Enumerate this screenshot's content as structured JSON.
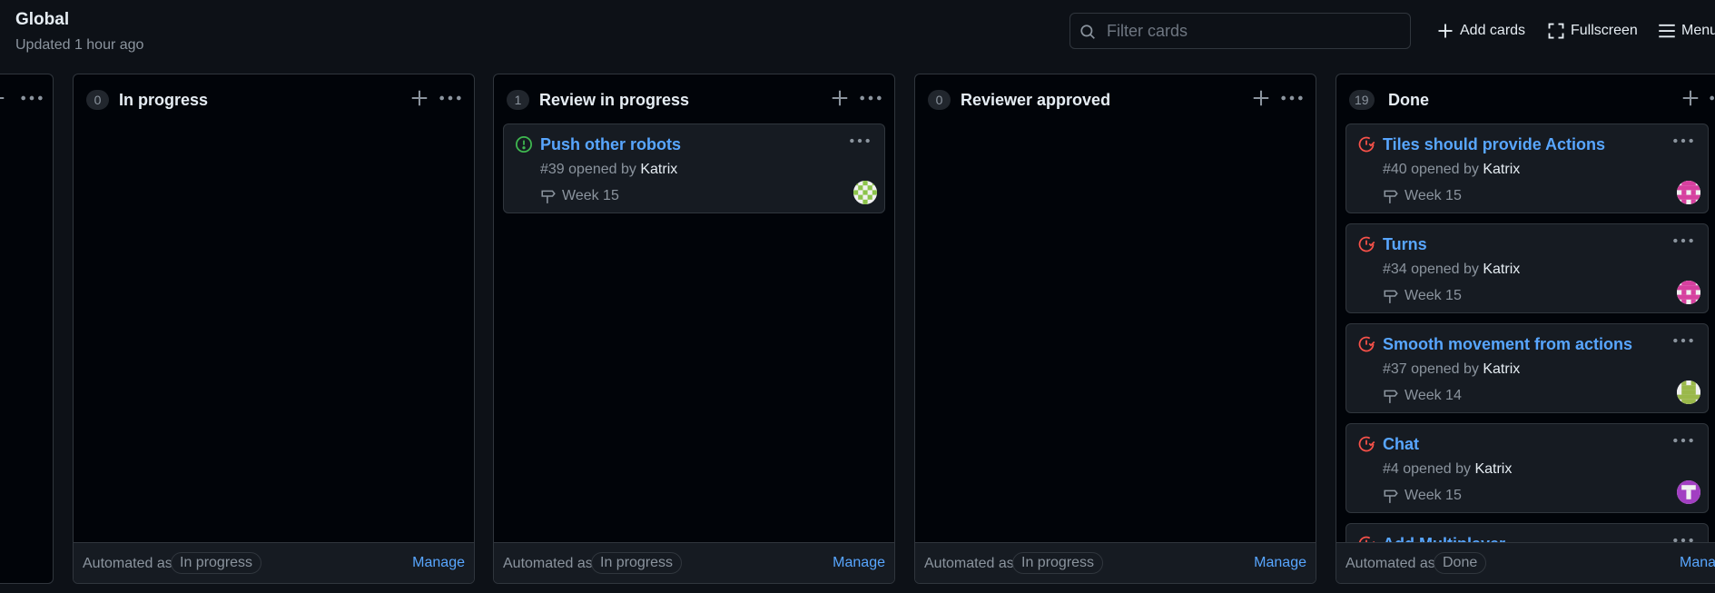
{
  "header": {
    "title": "Global",
    "subtitle": "Updated 1 hour ago",
    "filter_placeholder": "Filter cards",
    "add_cards_label": "Add cards",
    "fullscreen_label": "Fullscreen",
    "menu_label": "Menu"
  },
  "columns": [
    {
      "count": "0",
      "name": "In progress",
      "footer": {
        "automated_label": "Automated as",
        "automation": "In progress",
        "manage_label": "Manage"
      }
    },
    {
      "count": "1",
      "name": "Review in progress",
      "footer": {
        "automated_label": "Automated as",
        "automation": "In progress",
        "manage_label": "Manage"
      },
      "cards": [
        {
          "title": "Push other robots",
          "number": "#39",
          "opened_by": "opened by",
          "author": "Katrix",
          "milestone": "Week 15",
          "state": "open",
          "avatar": "green-identicon"
        }
      ]
    },
    {
      "count": "0",
      "name": "Reviewer approved",
      "footer": {
        "automated_label": "Automated as",
        "automation": "In progress",
        "manage_label": "Manage"
      }
    },
    {
      "count": "19",
      "name": "Done",
      "footer": {
        "automated_label": "Automated as",
        "automation": "Done",
        "manage_label": "Manage"
      },
      "cards": [
        {
          "title": "Tiles should provide Actions",
          "number": "#40",
          "opened_by": "opened by",
          "author": "Katrix",
          "milestone": "Week 15",
          "state": "closed",
          "avatar": "pink-identicon"
        },
        {
          "title": "Turns",
          "number": "#34",
          "opened_by": "opened by",
          "author": "Katrix",
          "milestone": "Week 15",
          "state": "closed",
          "avatar": "pink-identicon"
        },
        {
          "title": "Smooth movement from actions",
          "number": "#37",
          "opened_by": "opened by",
          "author": "Katrix",
          "milestone": "Week 14",
          "state": "closed",
          "avatar": "olive-identicon"
        },
        {
          "title": "Chat",
          "number": "#4",
          "opened_by": "opened by",
          "author": "Katrix",
          "milestone": "Week 15",
          "state": "closed",
          "avatar": "purple-identicon"
        },
        {
          "title": "Add Multiplayer",
          "state": "closed"
        }
      ]
    }
  ],
  "colors": {
    "background": "#0d1117",
    "column_bg": "#010409",
    "card_bg": "#161b22",
    "border": "#30363d",
    "link": "#58a6ff",
    "muted": "#8b949e",
    "open_issue": "#3fb950",
    "closed_issue": "#f85149"
  }
}
